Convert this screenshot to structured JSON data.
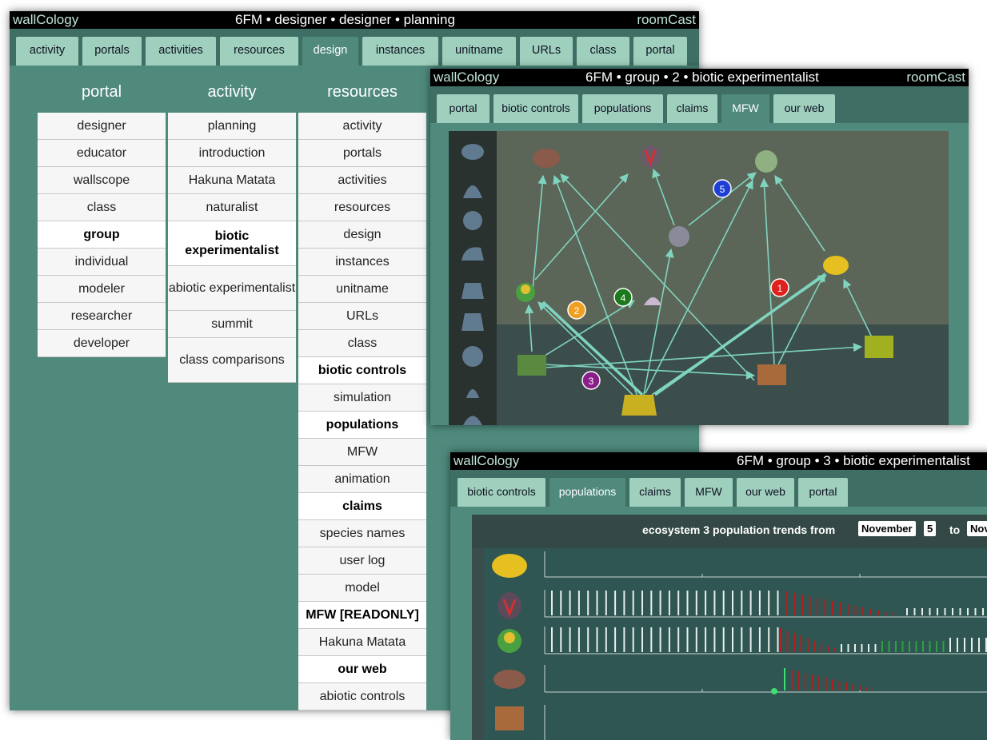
{
  "w1": {
    "app": "wallCology",
    "title": "6FM • designer • designer • planning",
    "brand": "roomCast",
    "tabs": [
      "activity",
      "portals",
      "activities",
      "resources",
      "design",
      "instances",
      "unitname",
      "URLs",
      "class",
      "portal"
    ],
    "active_tab": "design",
    "columns": {
      "portal": {
        "header": "portal",
        "items": [
          "designer",
          "educator",
          "wallscope",
          "class",
          "group",
          "individual",
          "modeler",
          "researcher",
          "developer"
        ],
        "bold": [
          "group"
        ]
      },
      "activity": {
        "header": "activity",
        "items": [
          "planning",
          "introduction",
          "Hakuna Matata",
          "naturalist",
          "biotic experimentalist",
          "abiotic experimentalist",
          "summit",
          "class comparisons"
        ],
        "bold": [
          "biotic experimentalist"
        ]
      },
      "resources": {
        "header": "resources",
        "items": [
          "activity",
          "portals",
          "activities",
          "resources",
          "design",
          "instances",
          "unitname",
          "URLs",
          "class",
          "biotic controls",
          "simulation",
          "populations",
          "MFW",
          "animation",
          "claims",
          "species names",
          "user log",
          "model",
          "MFW [READONLY]",
          "Hakuna Matata",
          "our web",
          "abiotic controls"
        ],
        "bold": [
          "biotic controls",
          "populations",
          "claims",
          "MFW [READONLY]",
          "our web"
        ]
      }
    }
  },
  "w2": {
    "app": "wallCology",
    "title": "6FM • group • 2 • biotic experimentalist",
    "brand": "roomCast",
    "tabs": [
      "portal",
      "biotic controls",
      "populations",
      "claims",
      "MFW",
      "our web"
    ],
    "active_tab": "MFW",
    "claim_markers": [
      {
        "label": "1",
        "color": "#e0201c"
      },
      {
        "label": "2",
        "color": "#f0a020"
      },
      {
        "label": "3",
        "color": "#8a1f8a"
      },
      {
        "label": "4",
        "color": "#1b7a1b"
      },
      {
        "label": "5",
        "color": "#1d3fd6"
      }
    ]
  },
  "w3": {
    "app": "wallCology",
    "title": "6FM • group • 3 • biotic experimentalist",
    "tabs": [
      "biotic controls",
      "populations",
      "claims",
      "MFW",
      "our web",
      "portal"
    ],
    "active_tab": "populations",
    "trend_prefix": "ecosystem 3 population trends from",
    "from_month": "November",
    "from_day": "5",
    "to_word": "to",
    "to_month": "Nov"
  },
  "colors": {
    "background": "#4f8a7d",
    "tab": "#9ed0bd",
    "edge": "#7fd4c0",
    "red_bar": "#b02020",
    "green_bar": "#2fa040"
  }
}
